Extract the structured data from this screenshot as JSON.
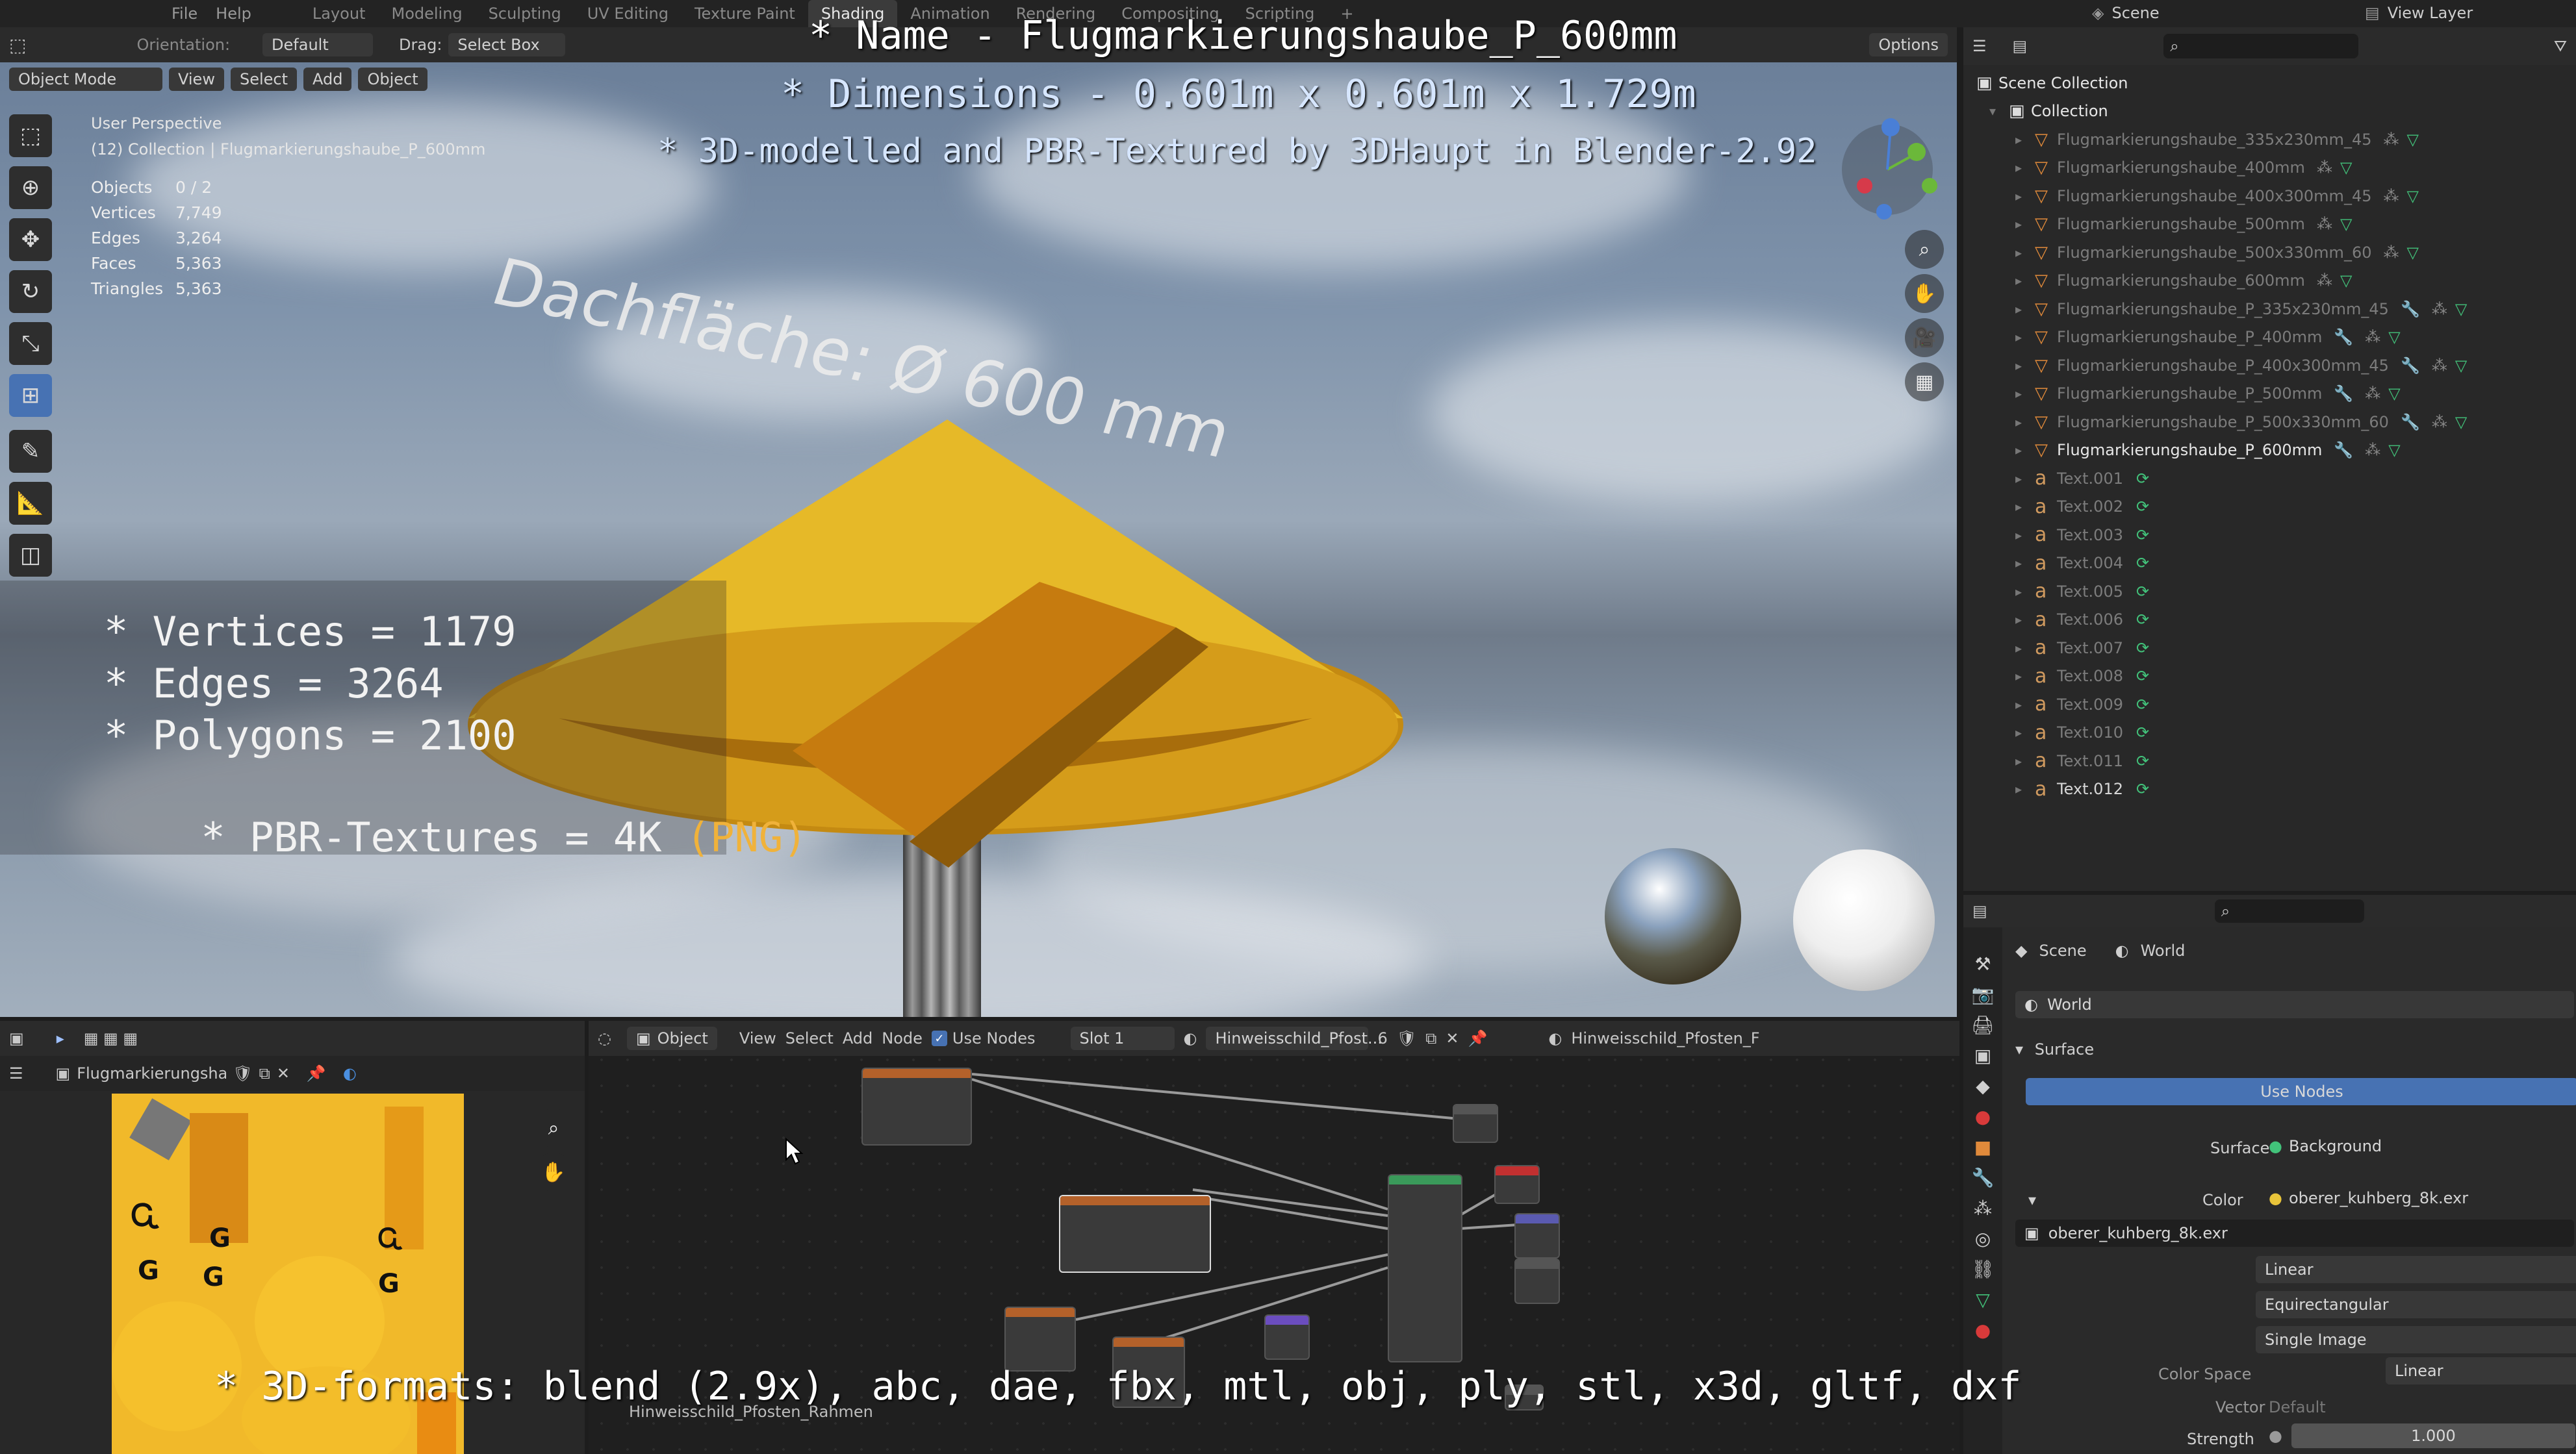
{
  "topbar": {
    "menus": [
      "File",
      "Help"
    ],
    "workspaces": [
      "Layout",
      "Modeling",
      "Sculpting",
      "UV Editing",
      "Texture Paint",
      "Shading",
      "Animation",
      "Rendering",
      "Compositing",
      "Scripting"
    ],
    "active_workspace": "Shading",
    "add_tab": "+",
    "scene_label": "Scene",
    "view_layer_label": "View Layer"
  },
  "viewport_header": {
    "orientation_label": "Orientation:",
    "orientation_value": "Default",
    "drag_label": "Drag:",
    "drag_value": "Select Box",
    "options": "Options",
    "mode": "Object Mode",
    "menus": [
      "View",
      "Select",
      "Add",
      "Object"
    ]
  },
  "viewport": {
    "perspective": "User Perspective",
    "collection_path": "(12) Collection | Flugmarkierungshaube_P_600mm",
    "stats": [
      {
        "label": "Objects",
        "value": "0 / 2"
      },
      {
        "label": "Vertices",
        "value": "7,749"
      },
      {
        "label": "Edges",
        "value": "3,264"
      },
      {
        "label": "Faces",
        "value": "5,363"
      },
      {
        "label": "Triangles",
        "value": "5,363"
      }
    ],
    "scene_text": "Dachfläche:  Ø 600 mm"
  },
  "overlay": {
    "name_line": "* Name - Flugmarkierungshaube_P_600mm",
    "dimensions_line": "* Dimensions -  0.601m x 0.601m x 1.729m",
    "modelled_line": "* 3D-modelled and PBR-Textured by 3DHaupt in Blender-2.92",
    "vertices_line": "* Vertices = 1179",
    "edges_line": "* Edges = 3264",
    "polygons_line": "* Polygons = 2100",
    "textures_line_a": "* PBR-Textures = 4K ",
    "textures_line_b": "(PNG)",
    "formats_line": "* 3D-formats: blend (2.9x), abc, dae, fbx, mtl, obj, ply, stl, x3d, gltf, dxf"
  },
  "outliner": {
    "scene_collection": "Scene Collection",
    "collection": "Collection",
    "objects": [
      "Flugmarkierungshaube_335x230mm_45",
      "Flugmarkierungshaube_400mm",
      "Flugmarkierungshaube_400x300mm_45",
      "Flugmarkierungshaube_500mm",
      "Flugmarkierungshaube_500x330mm_60",
      "Flugmarkierungshaube_600mm",
      "Flugmarkierungshaube_P_335x230mm_45",
      "Flugmarkierungshaube_P_400mm",
      "Flugmarkierungshaube_P_400x300mm_45",
      "Flugmarkierungshaube_P_500mm",
      "Flugmarkierungshaube_P_500x330mm_60",
      "Flugmarkierungshaube_P_600mm"
    ],
    "texts": [
      "Text.001",
      "Text.002",
      "Text.003",
      "Text.004",
      "Text.005",
      "Text.006",
      "Text.007",
      "Text.008",
      "Text.009",
      "Text.010",
      "Text.011",
      "Text.012"
    ]
  },
  "properties": {
    "tab_scene": "Scene",
    "tab_world": "World",
    "world_name": "World",
    "panel_surface": "Surface",
    "use_nodes_btn": "Use Nodes",
    "surface_label": "Surface",
    "surface_value": "Background",
    "color_label": "Color",
    "color_value": "oberer_kuhberg_8k.exr",
    "image_name": "oberer_kuhberg_8k.exr",
    "interp": "Linear",
    "projection": "Equirectangular",
    "source": "Single Image",
    "colorspace_label": "Color Space",
    "colorspace_value": "Linear",
    "vector_label": "Vector",
    "vector_value": "Default",
    "strength_label": "Strength",
    "strength_value": "1.000"
  },
  "image_editor": {
    "image_name": "Flugmarkierungshau..."
  },
  "node_editor": {
    "object_menu": "Object",
    "menus": [
      "View",
      "Select",
      "Add",
      "Node"
    ],
    "use_nodes": "Use Nodes",
    "slot": "Slot 1",
    "material": "Hinweisschild_Pfost...",
    "users": "6",
    "material_right": "Hinweisschild_Pfosten_F",
    "frame_label": "Hinweisschild_Pfosten_Rahmen"
  }
}
